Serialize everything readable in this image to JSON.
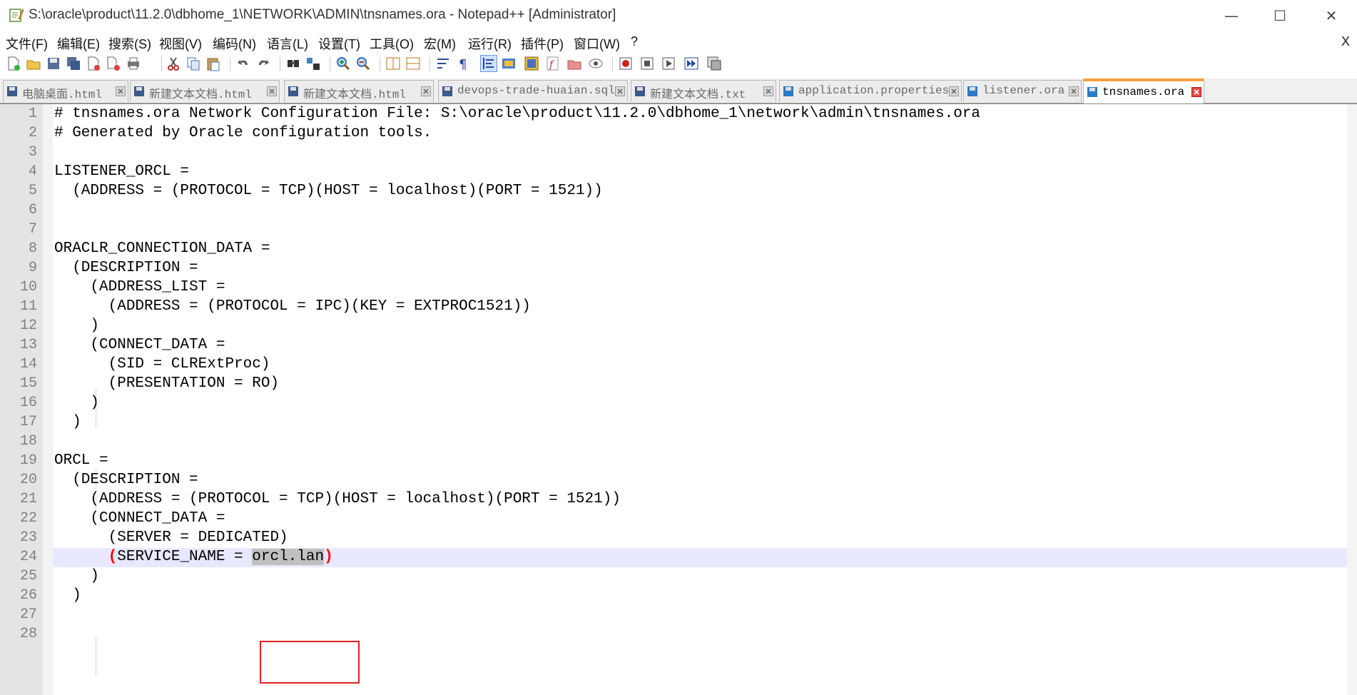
{
  "window": {
    "title": "S:\\oracle\\product\\11.2.0\\dbhome_1\\NETWORK\\ADMIN\\tnsnames.ora - Notepad++ [Administrator]",
    "min_glyph": "—",
    "max_glyph": "☐",
    "close_glyph": "✕"
  },
  "menu": {
    "items": [
      "文件(F)",
      "编辑(E)",
      "搜索(S)",
      "视图(V)",
      "编码(N)",
      "语言(L)",
      "设置(T)",
      "工具(O)",
      "宏(M)",
      "运行(R)",
      "插件(P)",
      "窗口(W)",
      "?"
    ],
    "close_label": "X"
  },
  "toolbar": {
    "icons": [
      "new-file-icon",
      "open-file-icon",
      "save-icon",
      "save-all-icon",
      "close-icon",
      "close-all-icon",
      "print-icon",
      "cut-icon",
      "copy-icon",
      "paste-icon",
      "undo-icon",
      "redo-icon",
      "find-icon",
      "replace-icon",
      "zoom-in-icon",
      "zoom-out-icon",
      "sync-v-icon",
      "sync-h-icon",
      "word-wrap-icon",
      "show-all-chars-icon",
      "indent-guide-icon",
      "user-lang-icon",
      "doc-map-icon",
      "function-list-icon",
      "folder-as-workspace-icon",
      "monitoring-icon",
      "record-macro-icon",
      "stop-record-icon",
      "play-macro-icon",
      "run-macro-multiple-icon",
      "save-macro-icon"
    ]
  },
  "tabs": [
    {
      "label": "电脑桌面.html",
      "active": false
    },
    {
      "label": "新建文本文档.html",
      "active": false
    },
    {
      "label": "新建文本文档.html",
      "active": false
    },
    {
      "label": "devops-trade-huaian.sql",
      "active": false
    },
    {
      "label": "新建文本文档.txt",
      "active": false
    },
    {
      "label": "application.properties",
      "active": false
    },
    {
      "label": "listener.ora",
      "active": false
    },
    {
      "label": "tnsnames.ora",
      "active": true
    }
  ],
  "editor": {
    "current_line": 24,
    "lines": [
      "# tnsnames.ora Network Configuration File: S:\\oracle\\product\\11.2.0\\dbhome_1\\network\\admin\\tnsnames.ora",
      "# Generated by Oracle configuration tools.",
      "",
      "LISTENER_ORCL =",
      "  (ADDRESS = (PROTOCOL = TCP)(HOST = localhost)(PORT = 1521))",
      "",
      "",
      "ORACLR_CONNECTION_DATA =",
      "  (DESCRIPTION =",
      "    (ADDRESS_LIST =",
      "      (ADDRESS = (PROTOCOL = IPC)(KEY = EXTPROC1521))",
      "    )",
      "    (CONNECT_DATA =",
      "      (SID = CLRExtProc)",
      "      (PRESENTATION = RO)",
      "    )",
      "  )",
      "",
      "ORCL =",
      "  (DESCRIPTION =",
      "    (ADDRESS = (PROTOCOL = TCP)(HOST = localhost)(PORT = 1521))",
      "    (CONNECT_DATA =",
      "      (SERVER = DEDICATED)",
      "      (SERVICE_NAME = orcl.lan)",
      "    )",
      "  )",
      "",
      ""
    ],
    "line24": {
      "open": "(",
      "mid": "SERVICE_NAME = ",
      "sel": "orcl.lan",
      "close": ")"
    }
  },
  "colors": {
    "active_tab_accent": "#f5a142",
    "current_line_bg": "#e8e8ff",
    "annotation_box": "#e02020",
    "brace_match": "#ff0000"
  }
}
